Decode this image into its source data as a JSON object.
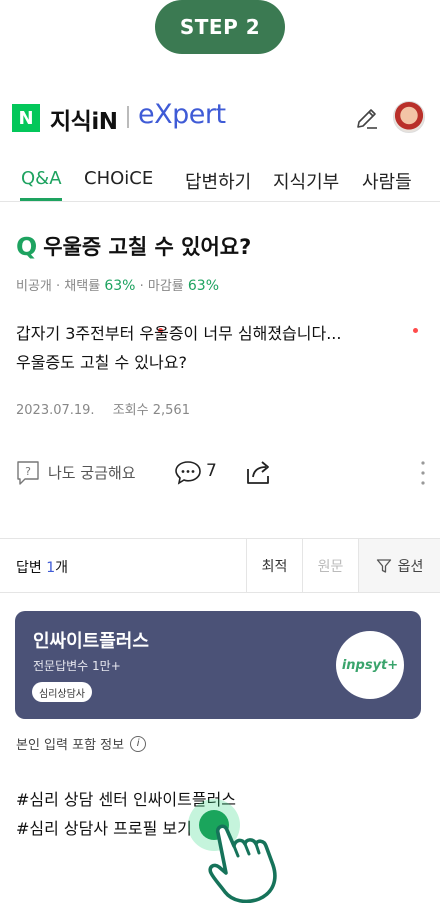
{
  "step": {
    "label": "STEP 2"
  },
  "header": {
    "naver_letter": "N",
    "kin": "지식iN",
    "expert": "eXpert"
  },
  "tabs": [
    {
      "label": "Q&A",
      "active": true
    },
    {
      "label": "CHOiCE",
      "dot": true
    },
    {
      "label": "답변하기"
    },
    {
      "label": "지식기부"
    },
    {
      "label": "사람들",
      "dot": true
    }
  ],
  "question": {
    "mark": "Q",
    "title": "우울증 고칠 수 있어요?",
    "meta": {
      "visibility": "비공개",
      "adopt_label": "채택률",
      "adopt_rate": "63%",
      "close_label": "마감률",
      "close_rate": "63%"
    },
    "body": [
      "갑자기 3주전부터 우울증이 너무 심해졌습니다...",
      "우울증도 고칠 수 있나요?"
    ],
    "date": "2023.07.19.",
    "views_label": "조회수",
    "views": "2,561"
  },
  "actions": {
    "curious_label": "나도 궁금해요",
    "comment_count": "7"
  },
  "answers": {
    "label": "답변",
    "count": "1",
    "unit": "개",
    "sort_best": "최적",
    "sort_original": "원문",
    "options": "옵션"
  },
  "expert_card": {
    "name": "인싸이트플러스",
    "subtitle": "전문답변수 1만+",
    "badge": "심리상담사",
    "logo_text": "inpsyt+"
  },
  "info": {
    "label": "본인 입력 포함 정보",
    "icon": "i"
  },
  "hashtags": [
    "#심리 상담 센터 인싸이트플러스",
    "#심리 상담사 프로필 보기"
  ],
  "colors": {
    "step": "#3b7a52",
    "accent_green": "#1ea360",
    "expert_blue": "#3f5bd6",
    "card_bg": "#4b5277"
  }
}
